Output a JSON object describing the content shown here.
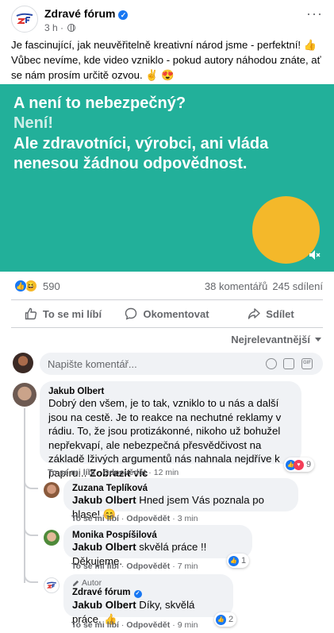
{
  "post": {
    "page_name": "Zdravé fórum",
    "time": "3 h",
    "text": "Je fascinující, jak neuvěřitelně kreativní národ jsme - perfektní! 👍 Vůbec nevíme, kde video vzniklo - pokud autory náhodou znáte, ať se nám prosím určitě ozvou. ✌️ 😍"
  },
  "video": {
    "line1": "A není to nebezpečný?",
    "line2": "Není!",
    "line3": "Ale zdravotníci, výrobci, ani vláda nenesou žádnou odpovědnost."
  },
  "stats": {
    "reactions": "590",
    "comments": "38 komentářů",
    "shares": "245 sdílení"
  },
  "actions": {
    "like": "To se mi líbí",
    "comment": "Okomentovat",
    "share": "Sdílet"
  },
  "sort_label": "Nejrelevantnější",
  "composer": {
    "placeholder": "Napište komentář..."
  },
  "colors": {
    "brand": "#1877f2",
    "video_bg": "#22b09a",
    "video_circle": "#f4b82a"
  },
  "comments": [
    {
      "author": "Jakub Olbert",
      "text": "Dobrý den všem, je to tak, vzniklo to u nás a další jsou na cestě. Je to reakce na nechutné reklamy v rádiu. To, že jsou protizákonné, nikoho už bohužel nepřekvapí, ale nebezpečná přesvědčivost na základě lživých argumentů nás nahnala nejdříve k papíru...",
      "more": "Zobrazit víc",
      "like": "To se mi líbí",
      "reply": "Odpovědět",
      "time": "12 min",
      "reactions": "9"
    },
    {
      "author": "Zuzana Teplíková",
      "tag": "Jakub Olbert",
      "text": " Hned jsem Vás poznala po hlase! 😊",
      "like": "To se mi líbí",
      "reply": "Odpovědět",
      "time": "3 min"
    },
    {
      "author": "Monika Pospíšilová",
      "tag": "Jakub Olbert",
      "text": " skvělá práce !! Děkujeme.",
      "like": "To se mi líbí",
      "reply": "Odpovědět",
      "time": "7 min",
      "reactions": "1"
    },
    {
      "badge": "Autor",
      "author": "Zdravé fórum",
      "tag": "Jakub Olbert",
      "text": " Díky, skvělá práce. 👍",
      "like": "To se mi líbí",
      "reply": "Odpovědět",
      "time": "9 min",
      "reactions": "2"
    }
  ]
}
